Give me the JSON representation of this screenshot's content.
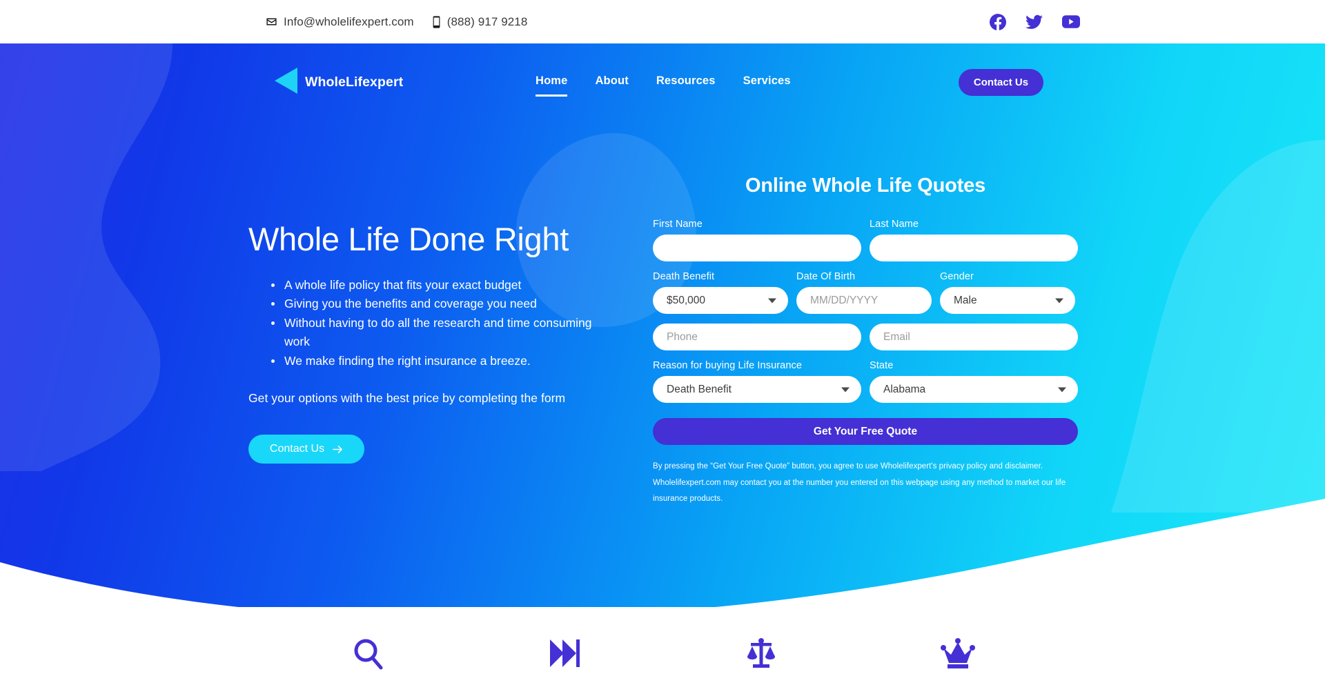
{
  "topbar": {
    "email": "Info@wholelifexpert.com",
    "phone": "(888) 917 9218",
    "email_icon": "envelope-icon",
    "phone_icon": "mobile-phone-icon",
    "social": [
      {
        "name": "facebook-icon",
        "label": "Facebook"
      },
      {
        "name": "twitter-icon",
        "label": "Twitter"
      },
      {
        "name": "youtube-icon",
        "label": "YouTube"
      }
    ]
  },
  "nav": {
    "brand_name": "WholeLifexpert",
    "brand_mark": "triangle-left-logo-icon",
    "links": [
      {
        "label": "Home",
        "active": true
      },
      {
        "label": "About",
        "active": false
      },
      {
        "label": "Resources",
        "active": false
      },
      {
        "label": "Services",
        "active": false
      }
    ],
    "cta_label": "Contact Us"
  },
  "hero": {
    "title": "Whole Life Done Right",
    "bullets": [
      "A whole life policy that fits your exact budget",
      "Giving you the benefits and coverage you need",
      "Without having to do all the research and time consuming work",
      "We make finding the right insurance a breeze."
    ],
    "subtext": "Get your options with the best price by completing the form",
    "cta_label": "Contact Us",
    "cta_icon": "arrow-right-icon"
  },
  "form": {
    "title": "Online Whole Life Quotes",
    "first_name": {
      "label": "First Name",
      "value": "",
      "placeholder": ""
    },
    "last_name": {
      "label": "Last Name",
      "value": "",
      "placeholder": ""
    },
    "death_benefit": {
      "label": "Death Benefit",
      "value": "$50,000"
    },
    "dob": {
      "label": "Date Of Birth",
      "value": "",
      "placeholder": "MM/DD/YYYY"
    },
    "gender": {
      "label": "Gender",
      "value": "Male"
    },
    "phone": {
      "label": "",
      "value": "",
      "placeholder": "Phone"
    },
    "email": {
      "label": "",
      "value": "",
      "placeholder": "Email"
    },
    "reason": {
      "label": "Reason for buying Life Insurance",
      "value": "Death Benefit"
    },
    "state": {
      "label": "State",
      "value": "Alabama"
    },
    "submit_label": "Get Your Free Quote",
    "disclaimer": "By pressing the “Get Your Free Quote” button, you agree to use Wholelifexpert's privacy policy and disclaimer. Wholelifexpert.com may contact you at the number you entered on this webpage using any method to market our life insurance products."
  },
  "features": [
    {
      "icon": "magnifier-search-icon"
    },
    {
      "icon": "fast-forward-icon"
    },
    {
      "icon": "scales-balance-icon"
    },
    {
      "icon": "crown-icon"
    }
  ],
  "colors": {
    "brand_purple": "#4430d4",
    "accent_cyan": "#19d7f9",
    "hero_blue_start": "#1f2ce8",
    "hero_blue_end": "#1ae8f9",
    "white": "#ffffff"
  }
}
